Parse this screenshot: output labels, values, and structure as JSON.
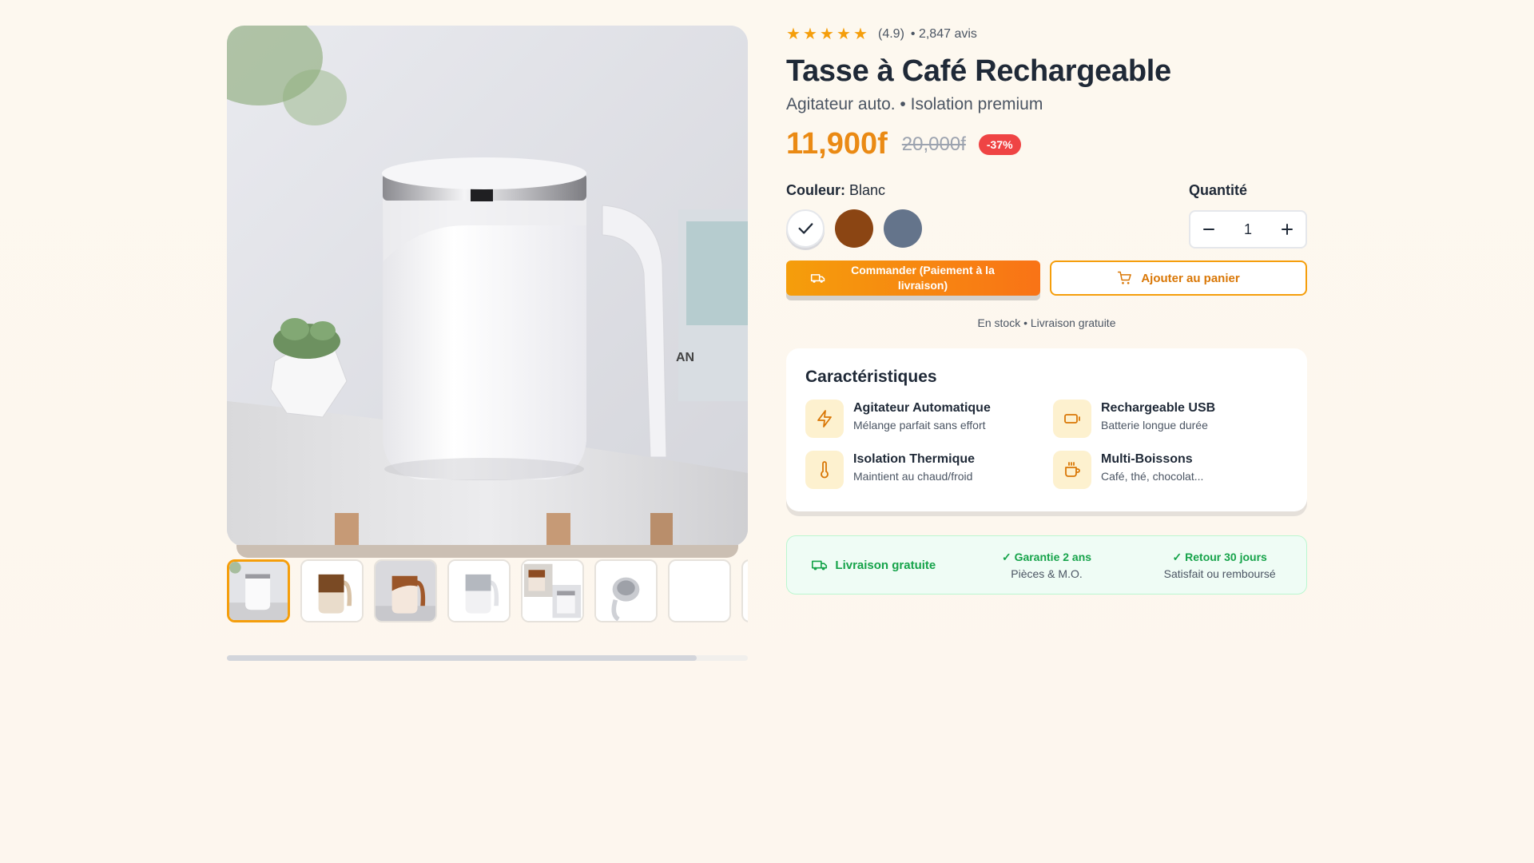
{
  "product": {
    "rating": "(4.9)",
    "reviews": "• 2,847 avis",
    "title": "Tasse à Café Rechargeable",
    "subtitle": "Agitateur auto. • Isolation premium",
    "price": "11,900f",
    "old_price": "20,000f",
    "discount": "-37%"
  },
  "options": {
    "color_label": "Couleur:",
    "color_value": "Blanc",
    "swatches": [
      {
        "name": "white",
        "color": "#ffffff",
        "selected": true
      },
      {
        "name": "brown",
        "color": "#8b4513",
        "selected": false
      },
      {
        "name": "slate",
        "color": "#64748b",
        "selected": false
      }
    ],
    "quantity_label": "Quantité",
    "quantity": "1"
  },
  "actions": {
    "order_label": "Commander (Paiement à la livraison)",
    "cart_label": "Ajouter au panier"
  },
  "stock_text": "En stock • Livraison gratuite",
  "features": {
    "heading": "Caractéristiques",
    "items": [
      {
        "title": "Agitateur Automatique",
        "desc": "Mélange parfait sans effort",
        "icon": "lightning-icon"
      },
      {
        "title": "Rechargeable USB",
        "desc": "Batterie longue durée",
        "icon": "battery-icon"
      },
      {
        "title": "Isolation Thermique",
        "desc": "Maintient au chaud/froid",
        "icon": "thermometer-icon"
      },
      {
        "title": "Multi-Boissons",
        "desc": "Café, thé, chocolat...",
        "icon": "coffee-cup-icon"
      }
    ]
  },
  "guarantees": {
    "shipping": "Livraison gratuite",
    "warranty_title": "Garantie 2 ans",
    "warranty_sub": "Pièces & M.O.",
    "return_title": "Retour 30 jours",
    "return_sub": "Satisfait ou remboursé"
  },
  "colors": {
    "accent": "#f59e0b",
    "price": "#ea8a14",
    "discount": "#ef4444",
    "success": "#16a34a"
  }
}
